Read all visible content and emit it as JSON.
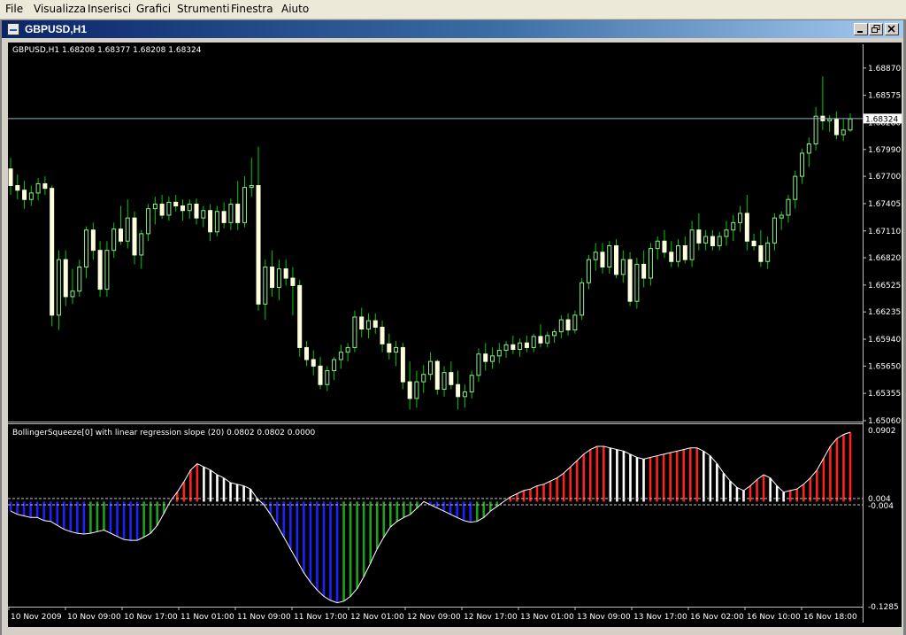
{
  "menu": {
    "items": [
      "File",
      "Visualizza",
      "Inserisci",
      "Grafici",
      "Strumenti",
      "Finestra",
      "Aiuto"
    ]
  },
  "window": {
    "title": "GBPUSD,H1"
  },
  "price_chart": {
    "info": "GBPUSD,H1  1.68208 1.68377 1.68208 1.68324",
    "current_price": "1.68324",
    "price_ticks": [
      "1.68870",
      "1.68575",
      "1.68280",
      "1.67990",
      "1.67700",
      "1.67405",
      "1.67110",
      "1.66820",
      "1.66525",
      "1.66235",
      "1.65940",
      "1.65650",
      "1.65355",
      "1.65060"
    ]
  },
  "indicator": {
    "info": "BollingerSqueeze[0] with linear regression slope (20) 0.0802 0.0802 0.0000",
    "ticks": {
      "top": "0.0902",
      "upper": "0.004",
      "lower": "-0.004",
      "bottom": "-0.1285"
    }
  },
  "time_axis": {
    "labels": [
      "10 Nov 2009",
      "10 Nov 09:00",
      "10 Nov 17:00",
      "11 Nov 01:00",
      "11 Nov 09:00",
      "11 Nov 17:00",
      "12 Nov 01:00",
      "12 Nov 09:00",
      "12 Nov 17:00",
      "13 Nov 01:00",
      "13 Nov 09:00",
      "13 Nov 17:00",
      "16 Nov 02:00",
      "16 Nov 10:00",
      "16 Nov 18:00"
    ]
  },
  "colors": {
    "background": "#000000",
    "candle_up": "#90ee90",
    "candle_down": "#ffffe0",
    "wick": "#00cc00",
    "squeeze_positive_strong": "#ff2020",
    "squeeze_positive_weak": "#ffffff",
    "squeeze_negative_strong": "#2020ff",
    "squeeze_negative_weak": "#20a020"
  },
  "chart_data": {
    "type": "candlestick",
    "symbol": "GBPUSD",
    "timeframe": "H1",
    "ylim": [
      1.6506,
      1.6905
    ],
    "candles": [
      [
        1.6778,
        1.679,
        1.675,
        1.676
      ],
      [
        1.676,
        1.6772,
        1.6745,
        1.6755
      ],
      [
        1.6755,
        1.6765,
        1.6735,
        1.6745
      ],
      [
        1.6745,
        1.676,
        1.6738,
        1.6752
      ],
      [
        1.6752,
        1.6768,
        1.6744,
        1.6762
      ],
      [
        1.6762,
        1.677,
        1.675,
        1.6757
      ],
      [
        1.6757,
        1.676,
        1.6608,
        1.662
      ],
      [
        1.662,
        1.669,
        1.6604,
        1.668
      ],
      [
        1.668,
        1.669,
        1.663,
        1.664
      ],
      [
        1.664,
        1.667,
        1.6632,
        1.6646
      ],
      [
        1.6646,
        1.668,
        1.664,
        1.6672
      ],
      [
        1.6672,
        1.6716,
        1.666,
        1.6712
      ],
      [
        1.6712,
        1.672,
        1.668,
        1.669
      ],
      [
        1.669,
        1.67,
        1.664,
        1.6648
      ],
      [
        1.6648,
        1.67,
        1.664,
        1.669
      ],
      [
        1.669,
        1.672,
        1.6682,
        1.6713
      ],
      [
        1.6713,
        1.6738,
        1.6696,
        1.67
      ],
      [
        1.67,
        1.6745,
        1.6692,
        1.6725
      ],
      [
        1.6725,
        1.6732,
        1.6675,
        1.6685
      ],
      [
        1.6685,
        1.6712,
        1.667,
        1.6708
      ],
      [
        1.6708,
        1.674,
        1.67,
        1.6735
      ],
      [
        1.6735,
        1.6748,
        1.6718,
        1.674
      ],
      [
        1.674,
        1.675,
        1.6724,
        1.6728
      ],
      [
        1.6728,
        1.6748,
        1.6722,
        1.6742
      ],
      [
        1.6742,
        1.675,
        1.6732,
        1.6738
      ],
      [
        1.6738,
        1.6745,
        1.6722,
        1.6733
      ],
      [
        1.6733,
        1.6745,
        1.6724,
        1.674
      ],
      [
        1.674,
        1.6746,
        1.6718,
        1.6725
      ],
      [
        1.6725,
        1.6738,
        1.6715,
        1.6733
      ],
      [
        1.6733,
        1.674,
        1.67,
        1.671
      ],
      [
        1.671,
        1.6738,
        1.6705,
        1.6732
      ],
      [
        1.6732,
        1.6742,
        1.6714,
        1.672
      ],
      [
        1.672,
        1.6746,
        1.6712,
        1.674
      ],
      [
        1.674,
        1.6765,
        1.6712,
        1.672
      ],
      [
        1.672,
        1.677,
        1.6715,
        1.6758
      ],
      [
        1.6758,
        1.679,
        1.6748,
        1.676
      ],
      [
        1.676,
        1.6802,
        1.6625,
        1.6632
      ],
      [
        1.6632,
        1.668,
        1.6615,
        1.6672
      ],
      [
        1.6672,
        1.669,
        1.664,
        1.665
      ],
      [
        1.665,
        1.668,
        1.6636,
        1.667
      ],
      [
        1.667,
        1.668,
        1.6652,
        1.666
      ],
      [
        1.666,
        1.6672,
        1.662,
        1.6652
      ],
      [
        1.6652,
        1.6658,
        1.6575,
        1.6585
      ],
      [
        1.6585,
        1.6592,
        1.6565,
        1.6572
      ],
      [
        1.6572,
        1.6582,
        1.6555,
        1.6565
      ],
      [
        1.6565,
        1.6575,
        1.654,
        1.6545
      ],
      [
        1.6545,
        1.6565,
        1.6538,
        1.656
      ],
      [
        1.656,
        1.6575,
        1.655,
        1.6572
      ],
      [
        1.6572,
        1.6588,
        1.6562,
        1.658
      ],
      [
        1.658,
        1.659,
        1.657,
        1.6585
      ],
      [
        1.6585,
        1.6625,
        1.658,
        1.6618
      ],
      [
        1.6618,
        1.6628,
        1.6596,
        1.6605
      ],
      [
        1.6605,
        1.6622,
        1.6595,
        1.6614
      ],
      [
        1.6614,
        1.6622,
        1.66,
        1.6607
      ],
      [
        1.6607,
        1.6614,
        1.658,
        1.6589
      ],
      [
        1.6589,
        1.66,
        1.6572,
        1.658
      ],
      [
        1.658,
        1.6592,
        1.6565,
        1.6585
      ],
      [
        1.6585,
        1.659,
        1.654,
        1.6548
      ],
      [
        1.6548,
        1.657,
        1.6518,
        1.653
      ],
      [
        1.653,
        1.656,
        1.652,
        1.6548
      ],
      [
        1.6548,
        1.6566,
        1.6536,
        1.6556
      ],
      [
        1.6556,
        1.658,
        1.655,
        1.657
      ],
      [
        1.657,
        1.6572,
        1.6534,
        1.654
      ],
      [
        1.654,
        1.6565,
        1.6532,
        1.6558
      ],
      [
        1.6558,
        1.657,
        1.654,
        1.6545
      ],
      [
        1.6545,
        1.656,
        1.6518,
        1.6532
      ],
      [
        1.6532,
        1.6545,
        1.652,
        1.6537
      ],
      [
        1.6537,
        1.656,
        1.653,
        1.6555
      ],
      [
        1.6555,
        1.6584,
        1.6548,
        1.6578
      ],
      [
        1.6578,
        1.659,
        1.656,
        1.657
      ],
      [
        1.657,
        1.6585,
        1.6562,
        1.6576
      ],
      [
        1.6576,
        1.659,
        1.6568,
        1.6582
      ],
      [
        1.6582,
        1.6592,
        1.6574,
        1.6588
      ],
      [
        1.6588,
        1.6598,
        1.6578,
        1.6583
      ],
      [
        1.6583,
        1.6595,
        1.6575,
        1.659
      ],
      [
        1.659,
        1.6598,
        1.658,
        1.6585
      ],
      [
        1.6585,
        1.66,
        1.658,
        1.6597
      ],
      [
        1.6597,
        1.661,
        1.6585,
        1.659
      ],
      [
        1.659,
        1.6602,
        1.6585,
        1.6598
      ],
      [
        1.6598,
        1.6605,
        1.659,
        1.6602
      ],
      [
        1.6602,
        1.662,
        1.6595,
        1.6615
      ],
      [
        1.6615,
        1.6622,
        1.6598,
        1.6604
      ],
      [
        1.6604,
        1.6625,
        1.66,
        1.662
      ],
      [
        1.662,
        1.666,
        1.6615,
        1.6655
      ],
      [
        1.6655,
        1.6685,
        1.6648,
        1.668
      ],
      [
        1.668,
        1.6698,
        1.6668,
        1.6688
      ],
      [
        1.6688,
        1.6698,
        1.6665,
        1.6672
      ],
      [
        1.6672,
        1.67,
        1.6665,
        1.6695
      ],
      [
        1.6695,
        1.6702,
        1.666,
        1.6664
      ],
      [
        1.6664,
        1.669,
        1.6655,
        1.668
      ],
      [
        1.668,
        1.6688,
        1.663,
        1.6635
      ],
      [
        1.6635,
        1.6682,
        1.6627,
        1.6675
      ],
      [
        1.6675,
        1.669,
        1.665,
        1.666
      ],
      [
        1.666,
        1.6698,
        1.6652,
        1.6692
      ],
      [
        1.6692,
        1.6705,
        1.668,
        1.67
      ],
      [
        1.67,
        1.6712,
        1.6682,
        1.6688
      ],
      [
        1.6688,
        1.67,
        1.6672,
        1.6678
      ],
      [
        1.6678,
        1.6702,
        1.6672,
        1.6695
      ],
      [
        1.6695,
        1.6705,
        1.6676,
        1.668
      ],
      [
        1.668,
        1.6722,
        1.6672,
        1.6712
      ],
      [
        1.6712,
        1.673,
        1.669,
        1.6698
      ],
      [
        1.6698,
        1.6712,
        1.669,
        1.6705
      ],
      [
        1.6705,
        1.6712,
        1.669,
        1.6695
      ],
      [
        1.6695,
        1.671,
        1.669,
        1.6705
      ],
      [
        1.6705,
        1.6722,
        1.6695,
        1.6712
      ],
      [
        1.6712,
        1.6728,
        1.67,
        1.672
      ],
      [
        1.672,
        1.6738,
        1.671,
        1.673
      ],
      [
        1.673,
        1.675,
        1.669,
        1.67
      ],
      [
        1.67,
        1.6708,
        1.669,
        1.6695
      ],
      [
        1.6695,
        1.6712,
        1.6672,
        1.6678
      ],
      [
        1.6678,
        1.6705,
        1.667,
        1.6698
      ],
      [
        1.6698,
        1.673,
        1.669,
        1.6725
      ],
      [
        1.6725,
        1.6732,
        1.6712,
        1.6728
      ],
      [
        1.6728,
        1.675,
        1.672,
        1.6745
      ],
      [
        1.6745,
        1.6776,
        1.6735,
        1.677
      ],
      [
        1.677,
        1.68,
        1.6762,
        1.6795
      ],
      [
        1.6795,
        1.6812,
        1.678,
        1.6805
      ],
      [
        1.6805,
        1.6845,
        1.6798,
        1.6835
      ],
      [
        1.6835,
        1.6878,
        1.682,
        1.683
      ],
      [
        1.683,
        1.6836,
        1.6818,
        1.6832
      ],
      [
        1.6832,
        1.684,
        1.681,
        1.6815
      ],
      [
        1.6815,
        1.6832,
        1.6808,
        1.682
      ],
      [
        1.682,
        1.6838,
        1.6818,
        1.6832
      ]
    ],
    "indicator_values": [
      -0.012,
      -0.016,
      -0.018,
      -0.02,
      -0.02,
      -0.024,
      -0.025,
      -0.03,
      -0.035,
      -0.038,
      -0.04,
      -0.041,
      -0.04,
      -0.038,
      -0.036,
      -0.04,
      -0.044,
      -0.048,
      -0.049,
      -0.049,
      -0.045,
      -0.04,
      -0.03,
      -0.015,
      0.001,
      0.012,
      0.025,
      0.04,
      0.048,
      0.044,
      0.04,
      0.034,
      0.03,
      0.024,
      0.022,
      0.02,
      0.016,
      0.004,
      -0.004,
      -0.016,
      -0.03,
      -0.045,
      -0.06,
      -0.075,
      -0.09,
      -0.102,
      -0.112,
      -0.12,
      -0.125,
      -0.128,
      -0.126,
      -0.12,
      -0.11,
      -0.095,
      -0.078,
      -0.06,
      -0.045,
      -0.032,
      -0.025,
      -0.02,
      -0.016,
      -0.008,
      0.0,
      -0.004,
      -0.008,
      -0.012,
      -0.016,
      -0.02,
      -0.024,
      -0.026,
      -0.025,
      -0.02,
      -0.012,
      -0.006,
      0.0,
      0.006,
      0.01,
      0.014,
      0.016,
      0.02,
      0.022,
      0.026,
      0.03,
      0.036,
      0.044,
      0.052,
      0.06,
      0.066,
      0.07,
      0.07,
      0.068,
      0.066,
      0.064,
      0.06,
      0.056,
      0.054,
      0.056,
      0.058,
      0.06,
      0.062,
      0.064,
      0.066,
      0.068,
      0.068,
      0.064,
      0.058,
      0.048,
      0.036,
      0.026,
      0.018,
      0.014,
      0.02,
      0.028,
      0.034,
      0.03,
      0.02,
      0.012,
      0.014,
      0.016,
      0.022,
      0.03,
      0.04,
      0.055,
      0.07,
      0.08,
      0.085,
      0.088
    ],
    "indicator_ylim": [
      -0.1285,
      0.0902
    ]
  }
}
